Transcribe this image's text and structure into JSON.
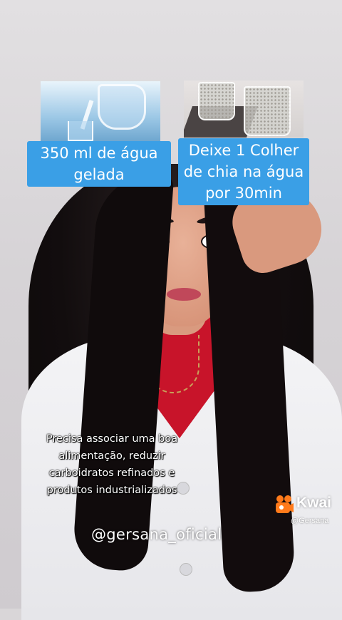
{
  "top_images": [
    {
      "name": "water-pitcher-photo",
      "description_icon": "pitcher-icon"
    },
    {
      "name": "chia-glasses-photo",
      "description_icon": "glass-icon"
    }
  ],
  "captions": {
    "water": "350 ml de água gelada",
    "chia": "Deixe 1 Colher de chia na água por 30min"
  },
  "tip_text": "Precisa associar uma boa alimentação, reduzir carboidratos refinados e produtos industrializados",
  "handle": "@gersana_oficial",
  "watermark": {
    "app_name": "Kwai",
    "user": "@Gersana",
    "logo_color": "#ff7a1a"
  },
  "colors": {
    "caption_bg": "#3a9fe6",
    "shirt": "#c8142a"
  }
}
